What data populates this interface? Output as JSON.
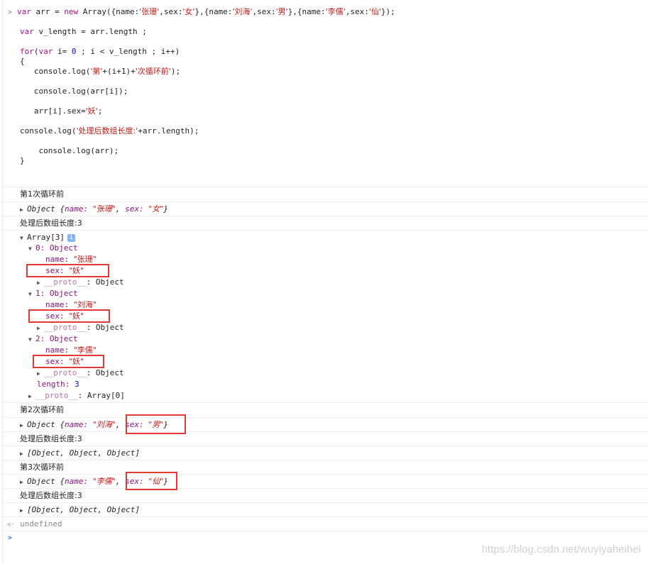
{
  "code": {
    "prompt_glyph": ">",
    "line1": {
      "a": "var",
      "b": " arr = ",
      "c": "new",
      "d": " Array({name:",
      "e": "'张珊'",
      "f": ",sex:",
      "g": "'女'",
      "h": "},{name:",
      "i": "'刘海'",
      "j": ",sex:",
      "k": "'男'",
      "l": "},{name:",
      "m": "'李儒'",
      "n": ",sex:",
      "o": "'仙'",
      "p": "});"
    },
    "line2": {
      "a": "var",
      "b": " v_length = arr.length ;"
    },
    "line3": {
      "a": "for",
      "b": "(",
      "c": "var",
      "d": " i= ",
      "e": "0",
      "f": " ; i < v_length ; i++)"
    },
    "line4": "{",
    "line5": {
      "a": "   console.log(",
      "b": "'第'",
      "c": "+(i+1)+",
      "d": "'次循环前'",
      "e": ");"
    },
    "line6": "   console.log(arr[i]);",
    "line7": {
      "a": "   arr[i].sex=",
      "b": "'妖'",
      "c": ";"
    },
    "line8": {
      "a": "console.log(",
      "b": "'处理后数组长度:'",
      "c": "+arr.length);"
    },
    "line9": "    console.log(arr);",
    "line10": "}"
  },
  "output": {
    "loop1_before": "第1次循环前",
    "loop1_obj": {
      "pre": "Object {",
      "k1": "name: ",
      "v1": "\"张珊\"",
      "c1": ", ",
      "k2": "sex: ",
      "v2": "\"女\"",
      "post": "}"
    },
    "len_label": "处理后数组长度:3",
    "array_head": "Array[3]",
    "info_icon": "i",
    "item0": {
      "head": "0: Object",
      "name_key": "name: ",
      "name_val": "\"张珊\"",
      "sex_key": "sex: ",
      "sex_val": "\"妖\"",
      "proto_key": "__proto__",
      "proto_val": ": Object"
    },
    "item1": {
      "head": "1: Object",
      "name_key": "name: ",
      "name_val": "\"刘海\"",
      "sex_key": "sex: ",
      "sex_val": "\"妖\"",
      "proto_key": "__proto__",
      "proto_val": ": Object"
    },
    "item2": {
      "head": "2: Object",
      "name_key": "name: ",
      "name_val": "\"李儒\"",
      "sex_key": "sex: ",
      "sex_val": "\"妖\"",
      "proto_key": "__proto__",
      "proto_val": ": Object"
    },
    "length_key": "length: ",
    "length_val": "3",
    "array_proto_key": "__proto__",
    "array_proto_val": ": Array[0]",
    "loop2_before": "第2次循环前",
    "loop2_obj": {
      "pre": "Object {",
      "k1": "name: ",
      "v1": "\"刘海\"",
      "c1": ", ",
      "k2": "sex: ",
      "v2": "\"男\"",
      "post": "}"
    },
    "len_label2": "处理后数组长度:3",
    "arr_collapsed": "[Object, Object, Object]",
    "loop3_before": "第3次循环前",
    "loop3_obj": {
      "pre": "Object {",
      "k1": "name: ",
      "v1": "\"李儒\"",
      "c1": ", ",
      "k2": "sex: ",
      "v2": "\"仙\"",
      "post": "}"
    },
    "len_label3": "处理后数组长度:3",
    "arr_collapsed2": "[Object, Object, Object]",
    "return_glyph": "<·",
    "result": "undefined",
    "input_prompt": ">"
  },
  "icons": {
    "expand": "triangle-right-icon",
    "collapse": "triangle-down-icon",
    "info": "info-icon"
  },
  "colors": {
    "keyword": "#aa0d91",
    "string": "#c41a16",
    "number": "#1c00cf",
    "property": "#881280",
    "highlight_box": "#e53935"
  },
  "watermark": "https://blog.csdn.net/wuyiyaheihei"
}
